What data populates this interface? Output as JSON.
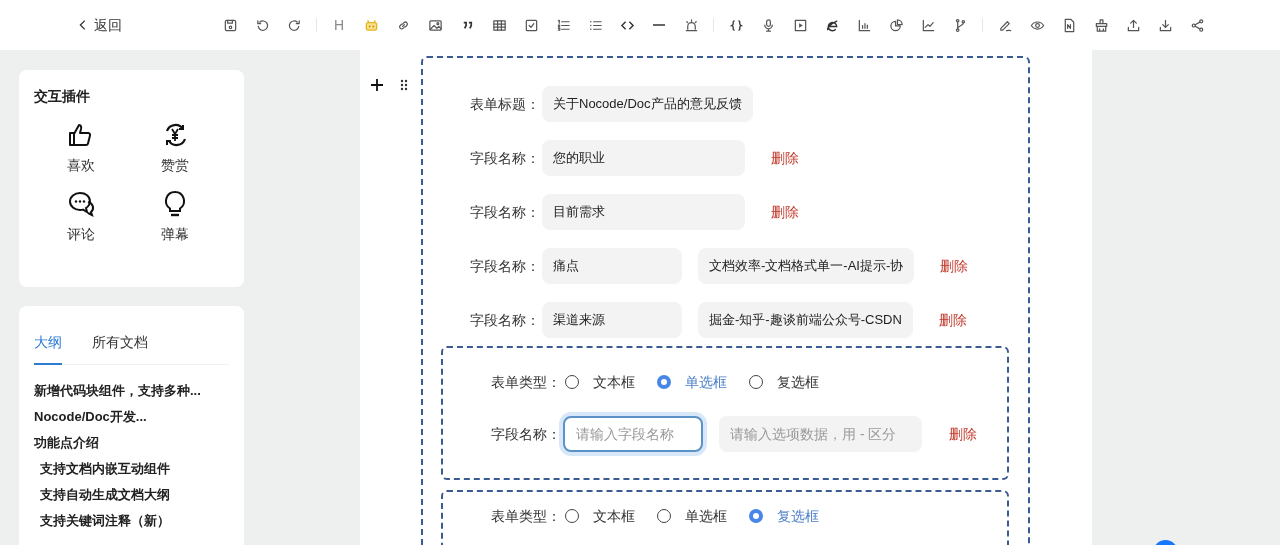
{
  "header": {
    "back": "返回",
    "toolbar": [
      {
        "kind": "save"
      },
      {
        "kind": "undo"
      },
      {
        "kind": "redo"
      },
      {
        "kind": "separator"
      },
      {
        "kind": "heading",
        "text": "H"
      },
      {
        "kind": "robot"
      },
      {
        "kind": "link"
      },
      {
        "kind": "image"
      },
      {
        "kind": "quote"
      },
      {
        "kind": "table"
      },
      {
        "kind": "checkbox"
      },
      {
        "kind": "ordered-list"
      },
      {
        "kind": "bullet-list"
      },
      {
        "kind": "code"
      },
      {
        "kind": "rule"
      },
      {
        "kind": "alarm"
      },
      {
        "kind": "separator"
      },
      {
        "kind": "braces"
      },
      {
        "kind": "mic"
      },
      {
        "kind": "play"
      },
      {
        "kind": "browser"
      },
      {
        "kind": "bar-chart"
      },
      {
        "kind": "pie-chart"
      },
      {
        "kind": "line-chart"
      },
      {
        "kind": "branch"
      },
      {
        "kind": "separator"
      },
      {
        "kind": "pen"
      },
      {
        "kind": "eye"
      },
      {
        "kind": "file"
      },
      {
        "kind": "brush"
      },
      {
        "kind": "upload"
      },
      {
        "kind": "download"
      },
      {
        "kind": "share"
      }
    ]
  },
  "plugins": {
    "title": "交互插件",
    "items": [
      {
        "kind": "like",
        "label": "喜欢"
      },
      {
        "kind": "reward",
        "label": "赞赏"
      },
      {
        "kind": "comment",
        "label": "评论"
      },
      {
        "kind": "bulb",
        "label": "弹幕"
      }
    ]
  },
  "outline": {
    "tabs": [
      {
        "label": "大纲",
        "selected": true
      },
      {
        "label": "所有文档",
        "selected": false
      }
    ],
    "items": [
      {
        "text": "新增代码块组件，支持多种..."
      },
      {
        "text": "Nocode/Doc开发..."
      },
      {
        "text": "功能点介绍",
        "children": [
          {
            "text": "支持文档内嵌互动组件"
          },
          {
            "text": "支持自动生成文档大纲"
          },
          {
            "text": "支持关键词注释（新）"
          }
        ]
      }
    ]
  },
  "form": {
    "title_label": "表单标题：",
    "title_value": "关于Nocode/Doc产品的意见反馈",
    "fields": [
      {
        "label": "字段名称：",
        "name": "您的职业",
        "delete": "删除"
      },
      {
        "label": "字段名称：",
        "name": "目前需求",
        "delete": "删除"
      },
      {
        "label": "字段名称：",
        "name": "痛点",
        "options": "文档效率-文档格式单一-AI提示-协",
        "delete": "删除"
      },
      {
        "label": "字段名称：",
        "name": "渠道来源",
        "options": "掘金-知乎-趣谈前端公众号-CSDN",
        "delete": "删除"
      }
    ],
    "new_fields": [
      {
        "type_label": "表单类型：",
        "types": [
          {
            "label": "文本框",
            "selected": false
          },
          {
            "label": "单选框",
            "selected": true
          },
          {
            "label": "复选框",
            "selected": false
          }
        ],
        "field_label": "字段名称：",
        "name_placeholder": "请输入字段名称",
        "options_placeholder": "请输入选项数据，用 - 区分",
        "delete": "删除",
        "focused": true
      },
      {
        "type_label": "表单类型：",
        "types": [
          {
            "label": "文本框",
            "selected": false
          },
          {
            "label": "单选框",
            "selected": false
          },
          {
            "label": "复选框",
            "selected": true
          }
        ]
      }
    ]
  }
}
